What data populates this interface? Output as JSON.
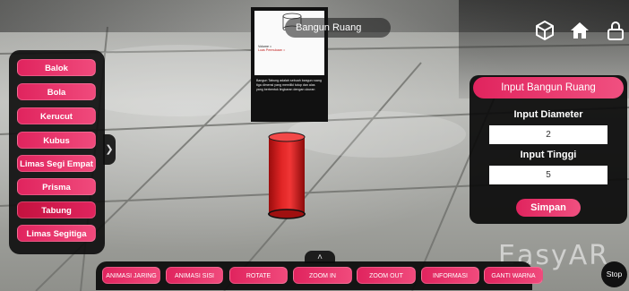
{
  "header": {
    "title": "Bangun Ruang"
  },
  "top_icons": [
    "cube-icon",
    "home-icon",
    "lock-icon"
  ],
  "board": {
    "lines": [
      "Volume =",
      "Luas Permukaan ="
    ],
    "description": "Bangun Tabung adalah sebuah bangun ruang tiga dimensi yang memiliki tutup dan alas yang berbentuk lingkaran dengan ukuran"
  },
  "sidebar": {
    "items": [
      {
        "label": "Balok"
      },
      {
        "label": "Bola"
      },
      {
        "label": "Kerucut"
      },
      {
        "label": "Kubus"
      },
      {
        "label": "Limas Segi Empat"
      },
      {
        "label": "Prisma"
      },
      {
        "label": "Tabung"
      },
      {
        "label": "Limas Segitiga"
      }
    ],
    "toggle_icon": "chevron-right-icon"
  },
  "panel": {
    "header": "Input Bangun Ruang",
    "diameter_label": "Input Diameter",
    "diameter_value": "2",
    "height_label": "Input Tinggi",
    "height_value": "5",
    "save_label": "Simpan"
  },
  "watermark": "EasyAR",
  "toolbar": {
    "toggle_icon": "chevron-up-icon",
    "items": [
      {
        "label": "ANIMASI JARING"
      },
      {
        "label": "ANIMASI SISI"
      },
      {
        "label": "ROTATE"
      },
      {
        "label": "ZOOM IN"
      },
      {
        "label": "ZOOM OUT"
      },
      {
        "label": "INFORMASI"
      },
      {
        "label": "GANTI WARNA"
      }
    ]
  },
  "stop_label": "Stop",
  "colors": {
    "accent": "#e0245e",
    "panel_bg": "#0a0a0a",
    "cylinder": "#d81c1c"
  }
}
